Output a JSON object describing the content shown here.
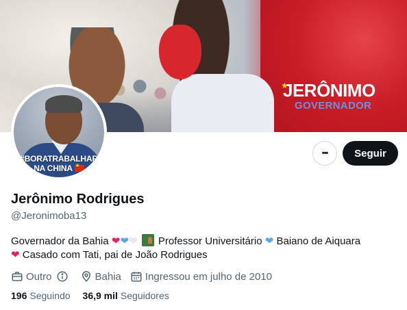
{
  "banner": {
    "brand_name": "JERÔNIMO",
    "brand_title": "GOVERNADOR"
  },
  "avatar": {
    "line1": "#BORATRABALHAR",
    "line2": "NA CHINA"
  },
  "actions": {
    "more_label": "•••",
    "follow_label": "Seguir"
  },
  "profile": {
    "name": "Jerônimo Rodrigues",
    "handle": "@Jeronimoba13"
  },
  "bio": {
    "part1": "Governador da Bahia",
    "part2": "Professor Universitário",
    "part3": "Baiano de Aiquara",
    "part4": "Casado com Tati, pai de João Rodrigues"
  },
  "meta": {
    "category": "Outro",
    "location": "Bahia",
    "joined": "Ingressou em julho de 2010"
  },
  "stats": {
    "following_count": "196",
    "following_label": "Seguindo",
    "followers_count": "36,9 mil",
    "followers_label": "Seguidores"
  },
  "colors": {
    "accent_dark": "#0f1419",
    "secondary_text": "#536471",
    "banner_red": "#c91c26"
  }
}
